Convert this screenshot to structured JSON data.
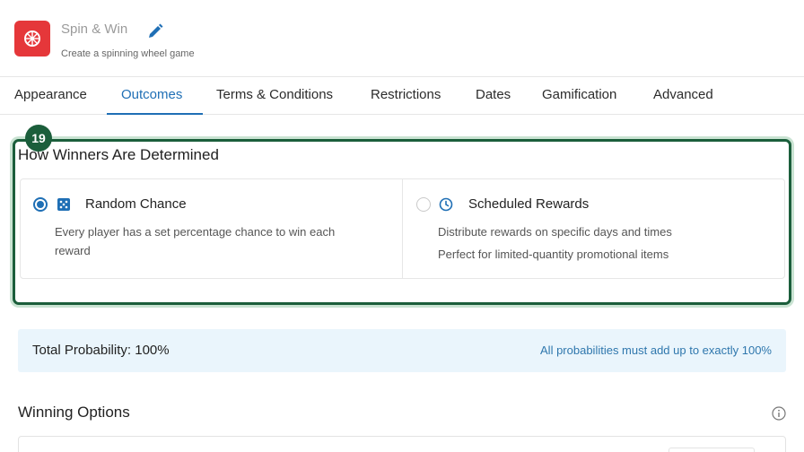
{
  "header": {
    "app_title": "Spin & Win",
    "app_subtitle": "Create a spinning wheel game",
    "brand_color": "#e5373a"
  },
  "tabs": [
    {
      "label": "Appearance",
      "active": false
    },
    {
      "label": "Outcomes",
      "active": true
    },
    {
      "label": "Terms & Conditions",
      "active": false
    },
    {
      "label": "Restrictions",
      "active": false
    },
    {
      "label": "Dates",
      "active": false
    },
    {
      "label": "Gamification",
      "active": false
    },
    {
      "label": "Advanced",
      "active": false
    }
  ],
  "section": {
    "badge": "19",
    "title": "How Winners Are Determined",
    "highlight_color": "#1b5e3b",
    "options": [
      {
        "label": "Random Chance",
        "icon": "dice-icon",
        "selected": true,
        "desc_lines": [
          "Every player has a set percentage chance to win each reward"
        ]
      },
      {
        "label": "Scheduled Rewards",
        "icon": "clock-icon",
        "selected": false,
        "desc_lines": [
          "Distribute rewards on specific days and times",
          "Perfect for limited-quantity promotional items"
        ]
      }
    ]
  },
  "probability": {
    "label": "Total Probability: 100%",
    "note": "All probabilities must add up to exactly 100%"
  },
  "winning_options": {
    "title": "Winning Options",
    "info_icon": "info-icon"
  },
  "colors": {
    "accent": "#1f6fb5",
    "info_bg": "#eaf5fc"
  }
}
